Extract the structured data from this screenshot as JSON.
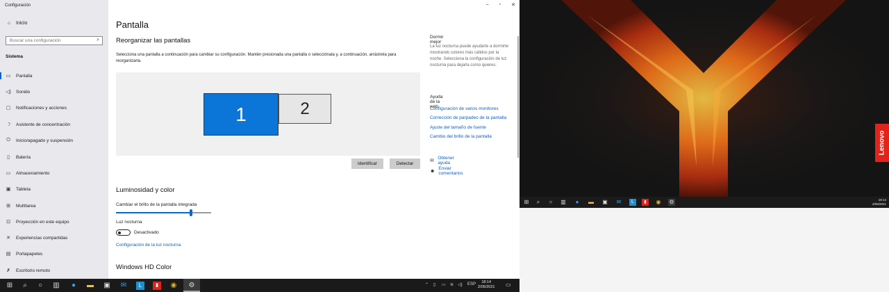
{
  "window": {
    "title": "Configuración",
    "min": "–",
    "max": "▫",
    "close": "✕"
  },
  "sidebar": {
    "home": "Inicio",
    "search_placeholder": "Buscar una configuración",
    "section": "Sistema",
    "items": [
      {
        "label": "Pantalla",
        "icon": "monitor-icon"
      },
      {
        "label": "Sonido",
        "icon": "speaker-icon"
      },
      {
        "label": "Notificaciones y acciones",
        "icon": "notification-icon"
      },
      {
        "label": "Asistente de concentración",
        "icon": "moon-icon"
      },
      {
        "label": "Inicio/apagado y suspensión",
        "icon": "power-icon"
      },
      {
        "label": "Batería",
        "icon": "battery-icon"
      },
      {
        "label": "Almacenamiento",
        "icon": "storage-icon"
      },
      {
        "label": "Tableta",
        "icon": "tablet-icon"
      },
      {
        "label": "Multitarea",
        "icon": "multitask-icon"
      },
      {
        "label": "Proyección en este equipo",
        "icon": "projection-icon"
      },
      {
        "label": "Experiencias compartidas",
        "icon": "share-icon"
      },
      {
        "label": "Portapapeles",
        "icon": "clipboard-icon"
      },
      {
        "label": "Escritorio remoto",
        "icon": "remote-icon"
      }
    ]
  },
  "main": {
    "title": "Pantalla",
    "arrange_heading": "Reorganizar las pantallas",
    "arrange_desc": "Selecciona una pantalla a continuación para cambiar su configuración. Mantén presionada una pantalla o selecciónala y, a continuación, arrástrela para reorganizarla.",
    "monitor1": "1",
    "monitor2": "2",
    "identify": "Identificar",
    "detect": "Detectar",
    "brightness_heading": "Luminosidad y color",
    "brightness_label": "Cambiar el brillo de la pantalla integrada",
    "brightness_level": 0.79,
    "night_light_label": "Luz nocturna",
    "night_light_state": "Desactivado",
    "night_light_link": "Configuración de la luz nocturna",
    "hdr_heading": "Windows HD Color"
  },
  "right": {
    "sleep_heading": "Dormir mejor",
    "sleep_text": "La luz nocturna puede ayudarte a dormirte mostrando colores más cálidos por la noche. Selecciona la configuración de luz nocturna para dejarla como quieres.",
    "web_heading": "Ayuda de la web",
    "links": [
      "Configuración de varios monitores",
      "Corrección de parpadeo de la pantalla",
      "Ajuste del tamaño de fuente",
      "Cambio del brillo de la pantalla"
    ],
    "get_help": "Obtener ayuda",
    "feedback": "Enviar comentarios"
  },
  "desktop2": {
    "brand": "Lenovo",
    "time": "18:14",
    "date": "2/05/2021"
  },
  "taskbar": {
    "lang": "ESP",
    "time": "18:14",
    "date": "2/05/2021"
  },
  "colors": {
    "accent": "#0a66c9",
    "monitor_selected": "#0c76d8",
    "lenovo_red": "#e2231a"
  }
}
